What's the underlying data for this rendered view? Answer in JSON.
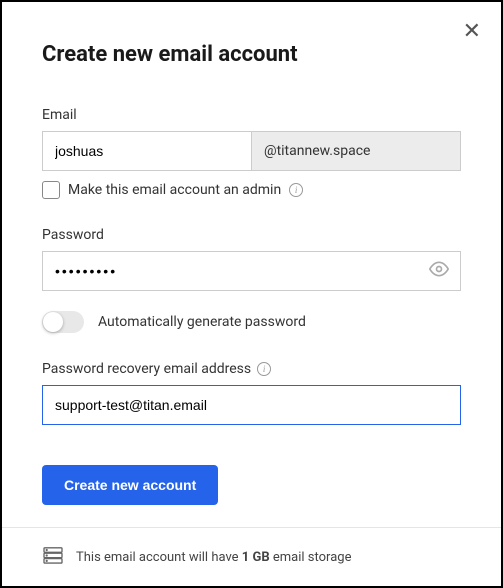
{
  "modal": {
    "title": "Create new email account"
  },
  "email": {
    "label": "Email",
    "value": "joshuas",
    "domain": "@titannew.space"
  },
  "admin": {
    "label": "Make this email account an admin"
  },
  "password": {
    "label": "Password",
    "value": "•••••••••"
  },
  "autogen": {
    "label": "Automatically generate password"
  },
  "recovery": {
    "label": "Password recovery email address",
    "value": "support-test@titan.email"
  },
  "submit": {
    "label": "Create new account"
  },
  "footer": {
    "prefix": "This email account will have ",
    "amount": "1 GB",
    "suffix": " email storage"
  }
}
